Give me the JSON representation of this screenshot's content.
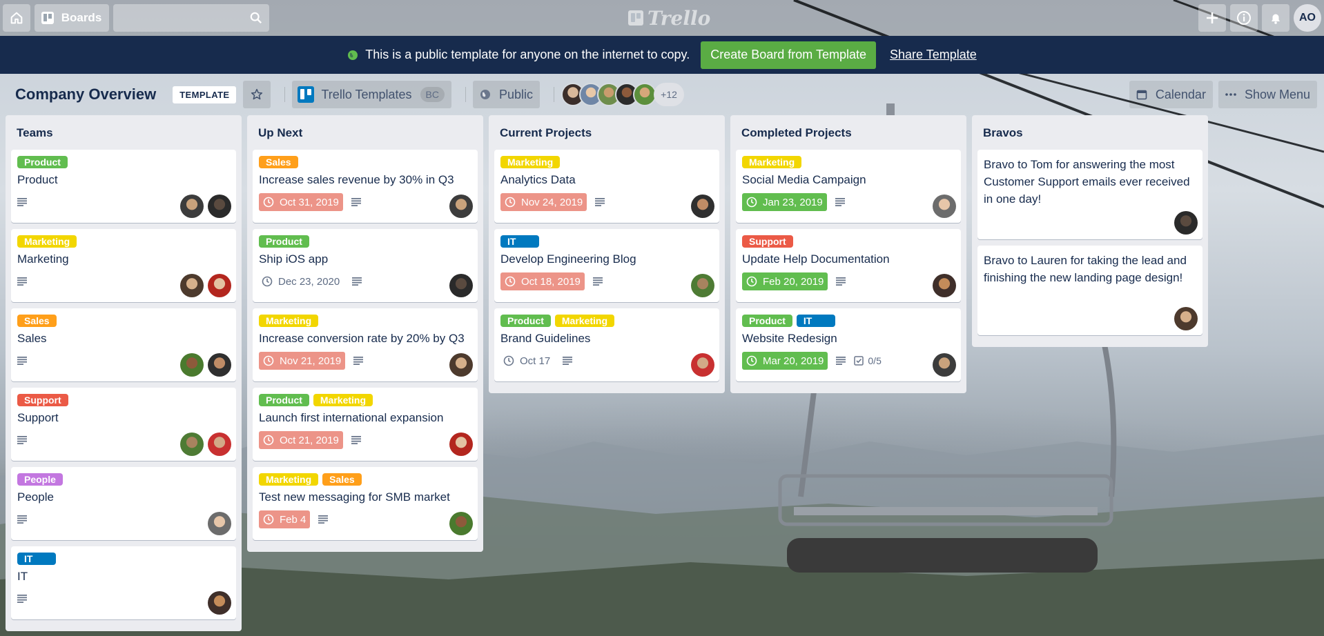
{
  "topbar": {
    "boards_label": "Boards",
    "search_placeholder": "",
    "logo_text": "Trello",
    "user_initials": "AO",
    "icons": [
      "home-icon",
      "boards-icon",
      "search-icon",
      "plus-icon",
      "info-icon",
      "bell-icon"
    ]
  },
  "banner": {
    "message": "This is a public template for anyone on the internet to copy.",
    "create_button": "Create Board from Template",
    "share_link": "Share Template"
  },
  "board": {
    "title": "Company Overview",
    "template_badge": "TEMPLATE",
    "team_name": "Trello Templates",
    "team_badge": "BC",
    "visibility": "Public",
    "extra_members": "+12",
    "calendar_label": "Calendar",
    "show_menu_label": "Show Menu"
  },
  "label_colors": {
    "Product": "#61bd4f",
    "Marketing": "#f2d600",
    "Sales": "#ff9f1a",
    "Support": "#eb5a46",
    "People": "#c377e0",
    "IT": "#0079bf"
  },
  "lists": [
    {
      "title": "Teams",
      "cards": [
        {
          "labels": [
            "Product"
          ],
          "title": "Product"
        },
        {
          "labels": [
            "Marketing"
          ],
          "title": "Marketing"
        },
        {
          "labels": [
            "Sales"
          ],
          "title": "Sales"
        },
        {
          "labels": [
            "Support"
          ],
          "title": "Support"
        },
        {
          "labels": [
            "People"
          ],
          "title": "People"
        },
        {
          "labels": [
            "IT"
          ],
          "title": "IT"
        }
      ]
    },
    {
      "title": "Up Next",
      "cards": [
        {
          "labels": [
            "Sales"
          ],
          "title": "Increase sales revenue by 30% in Q3",
          "due": "Oct 31, 2019"
        },
        {
          "labels": [
            "Product"
          ],
          "title": "Ship iOS app",
          "due": "Dec 23, 2020"
        },
        {
          "labels": [
            "Marketing"
          ],
          "title": "Increase conversion rate by 20% by Q3",
          "due": "Nov 21, 2019"
        },
        {
          "labels": [
            "Product",
            "Marketing"
          ],
          "title": "Launch first international expansion",
          "due": "Oct 21, 2019"
        },
        {
          "labels": [
            "Marketing",
            "Sales"
          ],
          "title": "Test new messaging for SMB market",
          "due": "Feb 4"
        }
      ]
    },
    {
      "title": "Current Projects",
      "cards": [
        {
          "labels": [
            "Marketing"
          ],
          "title": "Analytics Data",
          "due": "Nov 24, 2019"
        },
        {
          "labels": [
            "IT"
          ],
          "title": "Develop Engineering Blog",
          "due": "Oct 18, 2019"
        },
        {
          "labels": [
            "Product",
            "Marketing"
          ],
          "title": "Brand Guidelines",
          "due": "Oct 17"
        }
      ]
    },
    {
      "title": "Completed Projects",
      "cards": [
        {
          "labels": [
            "Marketing"
          ],
          "title": "Social Media Campaign",
          "due": "Jan 23, 2019"
        },
        {
          "labels": [
            "Support"
          ],
          "title": "Update Help Documentation",
          "due": "Feb 20, 2019"
        },
        {
          "labels": [
            "Product",
            "IT"
          ],
          "title": "Website Redesign",
          "due": "Mar 20, 2019",
          "checklist": "0/5"
        }
      ]
    },
    {
      "title": "Bravos",
      "cards": [
        {
          "title": "Bravo to Tom for answering the most Customer Support emails ever received in one day!"
        },
        {
          "title": "Bravo to Lauren for taking the lead and finishing the new landing page design!"
        }
      ]
    }
  ]
}
